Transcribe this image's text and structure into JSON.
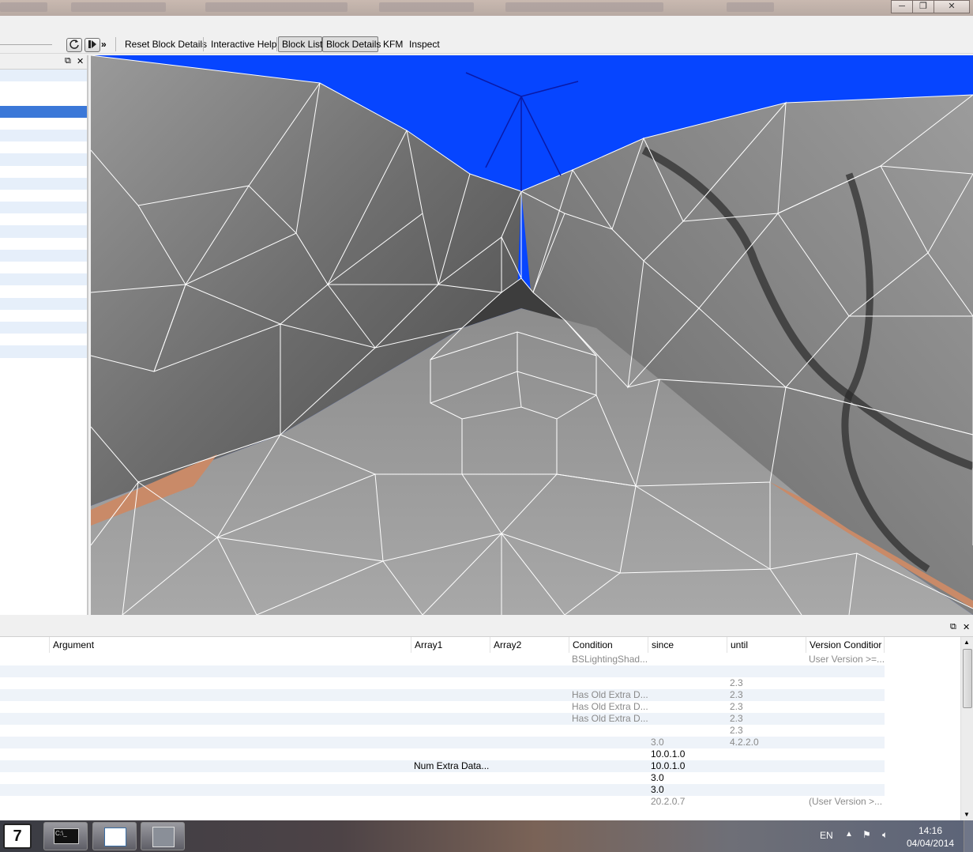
{
  "window": {
    "minimize_glyph": "─",
    "restore_glyph": "❐",
    "close_glyph": "✕"
  },
  "toolbar": {
    "overflow_glyph": "»",
    "buttons": [
      {
        "label": "Reset Block Details",
        "pressed": false
      },
      {
        "label": "Interactive Help",
        "pressed": false
      },
      {
        "label": "Block List",
        "pressed": true
      },
      {
        "label": "Block Details",
        "pressed": true
      },
      {
        "label": "KFM",
        "pressed": false
      },
      {
        "label": "Inspect",
        "pressed": false
      }
    ],
    "icons": [
      "refresh-icon",
      "play-pause-icon"
    ]
  },
  "panels": {
    "float_glyph": "⧉",
    "close_glyph": "✕"
  },
  "details": {
    "columns": [
      "Argument",
      "Array1",
      "Array2",
      "Condition",
      "since",
      "until",
      "Version Conditior"
    ],
    "rows": [
      {
        "argument": "",
        "array1": "",
        "array2": "",
        "condition": "BSLightingShad...",
        "since": "",
        "until": "",
        "version_condition": "User Version >=...",
        "since_dim": true,
        "until_dim": true
      },
      {
        "argument": "",
        "array1": "",
        "array2": "",
        "condition": "",
        "since": "",
        "until": "",
        "version_condition": "",
        "since_dim": true,
        "until_dim": true
      },
      {
        "argument": "",
        "array1": "",
        "array2": "",
        "condition": "",
        "since": "",
        "until": "2.3",
        "version_condition": "",
        "since_dim": true,
        "until_dim": true
      },
      {
        "argument": "",
        "array1": "",
        "array2": "",
        "condition": "Has Old Extra D...",
        "since": "",
        "until": "2.3",
        "version_condition": "",
        "since_dim": true,
        "until_dim": true
      },
      {
        "argument": "",
        "array1": "",
        "array2": "",
        "condition": "Has Old Extra D...",
        "since": "",
        "until": "2.3",
        "version_condition": "",
        "since_dim": true,
        "until_dim": true
      },
      {
        "argument": "",
        "array1": "",
        "array2": "",
        "condition": "Has Old Extra D...",
        "since": "",
        "until": "2.3",
        "version_condition": "",
        "since_dim": true,
        "until_dim": true
      },
      {
        "argument": "",
        "array1": "",
        "array2": "",
        "condition": "",
        "since": "",
        "until": "2.3",
        "version_condition": "",
        "since_dim": true,
        "until_dim": true
      },
      {
        "argument": "",
        "array1": "",
        "array2": "",
        "condition": "",
        "since": "3.0",
        "until": "4.2.2.0",
        "version_condition": "",
        "since_dim": true,
        "until_dim": true
      },
      {
        "argument": "",
        "array1": "",
        "array2": "",
        "condition": "",
        "since": "10.0.1.0",
        "until": "",
        "version_condition": "",
        "since_dim": false,
        "until_dim": false
      },
      {
        "argument": "",
        "array1": "Num Extra Data...",
        "array2": "",
        "condition": "",
        "since": "10.0.1.0",
        "until": "",
        "version_condition": "",
        "since_dim": false,
        "until_dim": false
      },
      {
        "argument": "",
        "array1": "",
        "array2": "",
        "condition": "",
        "since": "3.0",
        "until": "",
        "version_condition": "",
        "since_dim": false,
        "until_dim": false
      },
      {
        "argument": "",
        "array1": "",
        "array2": "",
        "condition": "",
        "since": "3.0",
        "until": "",
        "version_condition": "",
        "since_dim": false,
        "until_dim": false
      },
      {
        "argument": "",
        "array1": "",
        "array2": "",
        "condition": "",
        "since": "20.2.0.7",
        "until": "",
        "version_condition": "(User Version >...",
        "since_dim": true,
        "until_dim": true
      }
    ]
  },
  "taskbar": {
    "start_label": "7",
    "apps": [
      "command-prompt-app",
      "text-editor-app",
      "nifskope-app"
    ],
    "language": "EN",
    "time": "14:16",
    "date": "04/04/2014"
  },
  "colors": {
    "viewport_background": "#0645ff",
    "mesh_wire": "#ffffff",
    "selection_blue": "#3b78d8",
    "skin_tone": "#c98a68"
  }
}
